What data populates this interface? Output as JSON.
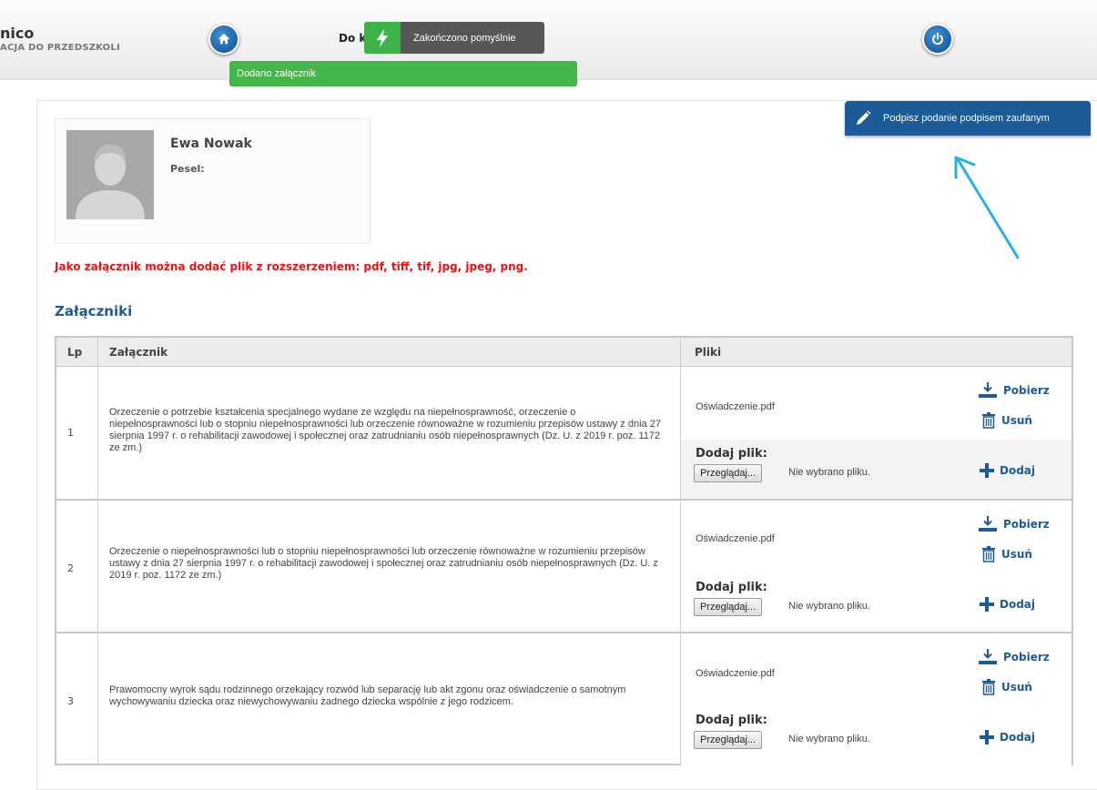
{
  "header": {
    "brand": "nico",
    "brand_sub": "ACJA DO PRZEDSZKOLI",
    "do_ko": "Do ko",
    "home_icon": "home-icon",
    "power_icon": "power-icon"
  },
  "toasts": {
    "success": "Zakończono pomyślnie",
    "added": "Dodano załącznik"
  },
  "sign_button": "Podpisz podanie podpisem zaufanym",
  "profile": {
    "name": "Ewa Nowak",
    "pesel_label": "Pesel:"
  },
  "notice": "Jako załącznik można dodać plik z rozszerzeniem: pdf, tiff, tif, jpg, jpeg, png.",
  "section_title": "Załączniki",
  "table": {
    "headers": {
      "lp": "Lp",
      "attachment": "Załącznik",
      "files": "Pliki"
    },
    "rows": [
      {
        "lp": "1",
        "description": "Orzeczenie o potrzebie kształcenia specjalnego wydane ze względu na niepełnosprawność, orzeczenie o niepełnosprawności lub o stopniu niepełnosprawności lub orzeczenie równoważne w rozumieniu przepisów ustawy z dnia 27 sierpnia 1997 r. o rehabilitacji zawodowej i społecznej oraz zatrudnianiu osób niepełnosprawnych (Dz. U. z 2019 r. poz. 1172 ze zm.)",
        "file": "Oświadczenie.pdf"
      },
      {
        "lp": "2",
        "description": "Orzeczenie o niepełnosprawności lub o stopniu niepełnosprawności lub orzeczenie równoważne w rozumieniu przepisów ustawy z dnia 27 sierpnia 1997 r. o rehabilitacji zawodowej i społecznej oraz zatrudnianiu osób niepełnosprawnych (Dz. U. z 2019 r. poz. 1172 ze zm.)",
        "file": "Oświadczenie.pdf"
      },
      {
        "lp": "3",
        "description": "Prawomocny wyrok sądu rodzinnego orzekający rozwód lub separację lub akt zgonu oraz oświadczenie o samotnym wychowywaniu dziecka oraz niewychowywaniu żadnego dziecka wspólnie z jego rodzicem.",
        "file": "Oświadczenie.pdf"
      }
    ],
    "labels": {
      "download": "Pobierz",
      "delete": "Usuń",
      "add_file": "Dodaj plik:",
      "browse": "Przeglądaj...",
      "no_file": "Nie wybrano pliku.",
      "add": "Dodaj"
    }
  },
  "colors": {
    "accent": "#1c5a98",
    "success": "#45b649",
    "notice": "#ee1111"
  }
}
